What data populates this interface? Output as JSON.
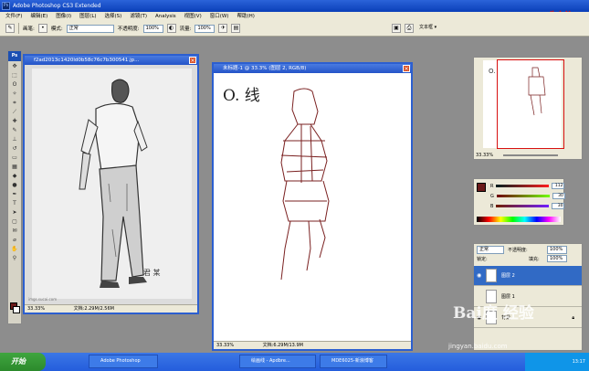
{
  "window": {
    "title": "Adobe Photoshop CS3 Extended",
    "watermark": "*** 制作"
  },
  "menu": [
    "文件(F)",
    "编辑(E)",
    "图像(I)",
    "图层(L)",
    "选择(S)",
    "滤镜(T)",
    "Analysis",
    "视图(V)",
    "窗口(W)",
    "帮助(H)"
  ],
  "options": {
    "brush_label": "画笔:",
    "mode_label": "模式:",
    "mode_value": "正常",
    "opacity_label": "不透明度:",
    "opacity_value": "100%",
    "flow_label": "流量:",
    "flow_value": "100%",
    "workspace": "文本框 ▾"
  },
  "toolbox": {
    "logo": "Ps"
  },
  "doc_photo": {
    "title": "f2ad2013c1420ld0b58c76c7b300541.jp...",
    "zoom": "33.33%",
    "doc_size": "文档:2.29M/2.56M",
    "watermark_credit": "imgs.sucai.com"
  },
  "doc_sketch": {
    "title": "未标题-1 @ 33.3% (图层 2, RGB/8)",
    "zoom": "33.33%",
    "doc_size": "文档:6.29M/13.9M",
    "sketch_text": "O. 线"
  },
  "navigator": {
    "zoom": "33.33%"
  },
  "color": {
    "fg": "#6b1a1a",
    "rows": [
      {
        "label": "R",
        "value": "112",
        "bar": "linear-gradient(90deg,#001e1e,#ff1e1e)"
      },
      {
        "label": "G",
        "value": "30",
        "bar": "linear-gradient(90deg,#700000,#70ff00)"
      },
      {
        "label": "B",
        "value": "30",
        "bar": "linear-gradient(90deg,#701e00,#701eff)"
      }
    ]
  },
  "layers": {
    "blend_mode": "正常",
    "opacity_label": "不透明度:",
    "opacity_value": "100%",
    "lock_label": "锁定:",
    "fill_label": "填充:",
    "fill_value": "100%",
    "rows": [
      {
        "name": "图层 2",
        "selected": true
      },
      {
        "name": "图层 1",
        "selected": false
      },
      {
        "name": "背景",
        "selected": false
      }
    ]
  },
  "taskbar": {
    "start": "开始",
    "items": [
      "Adobe Photoshop",
      "绘画线 - Apdbre...",
      "MDE6025-新浪博客"
    ],
    "time": "13:17"
  },
  "watermark": {
    "site": "Bai度 经验",
    "url": "jingyan.baidu.com"
  }
}
